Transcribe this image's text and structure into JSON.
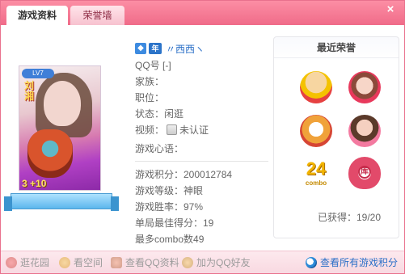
{
  "tabs": [
    {
      "label": "游戏资料",
      "active": true
    },
    {
      "label": "荣誉墙",
      "active": false
    }
  ],
  "close_label": "×",
  "avatar": {
    "level_badge": "LV7",
    "pet_name": "刘\n湘",
    "level_text": "3 +10"
  },
  "profile": {
    "year_icon": "年",
    "nickname": "〃西西ヽ",
    "qq": "QQ号 [-]",
    "ethnic": "家族：",
    "position": "职位：",
    "status": "状态：闲逛",
    "video_label": "视频：",
    "video_value": "未认证",
    "motto": "游戏心语："
  },
  "stats": {
    "score": "游戏积分：200012784",
    "level": "游戏等级：神眼",
    "winrate": "游戏胜率：97%",
    "best_score": "单局最佳得分：19",
    "combo": "最多combo数49"
  },
  "honors": {
    "title": "最近荣誉",
    "badge_24": "24",
    "badge_24_sub": "combo",
    "badge_ring": "库",
    "obtained": "已获得：19/20"
  },
  "bottom": {
    "garden": "逛花园",
    "space": "看空间",
    "qqinfo": "查看QQ资料",
    "addfriend": "加为QQ好友",
    "all_scores": "查看所有游戏积分"
  },
  "colors": {
    "accent": "#f06b89",
    "link": "#2a6fc7"
  }
}
